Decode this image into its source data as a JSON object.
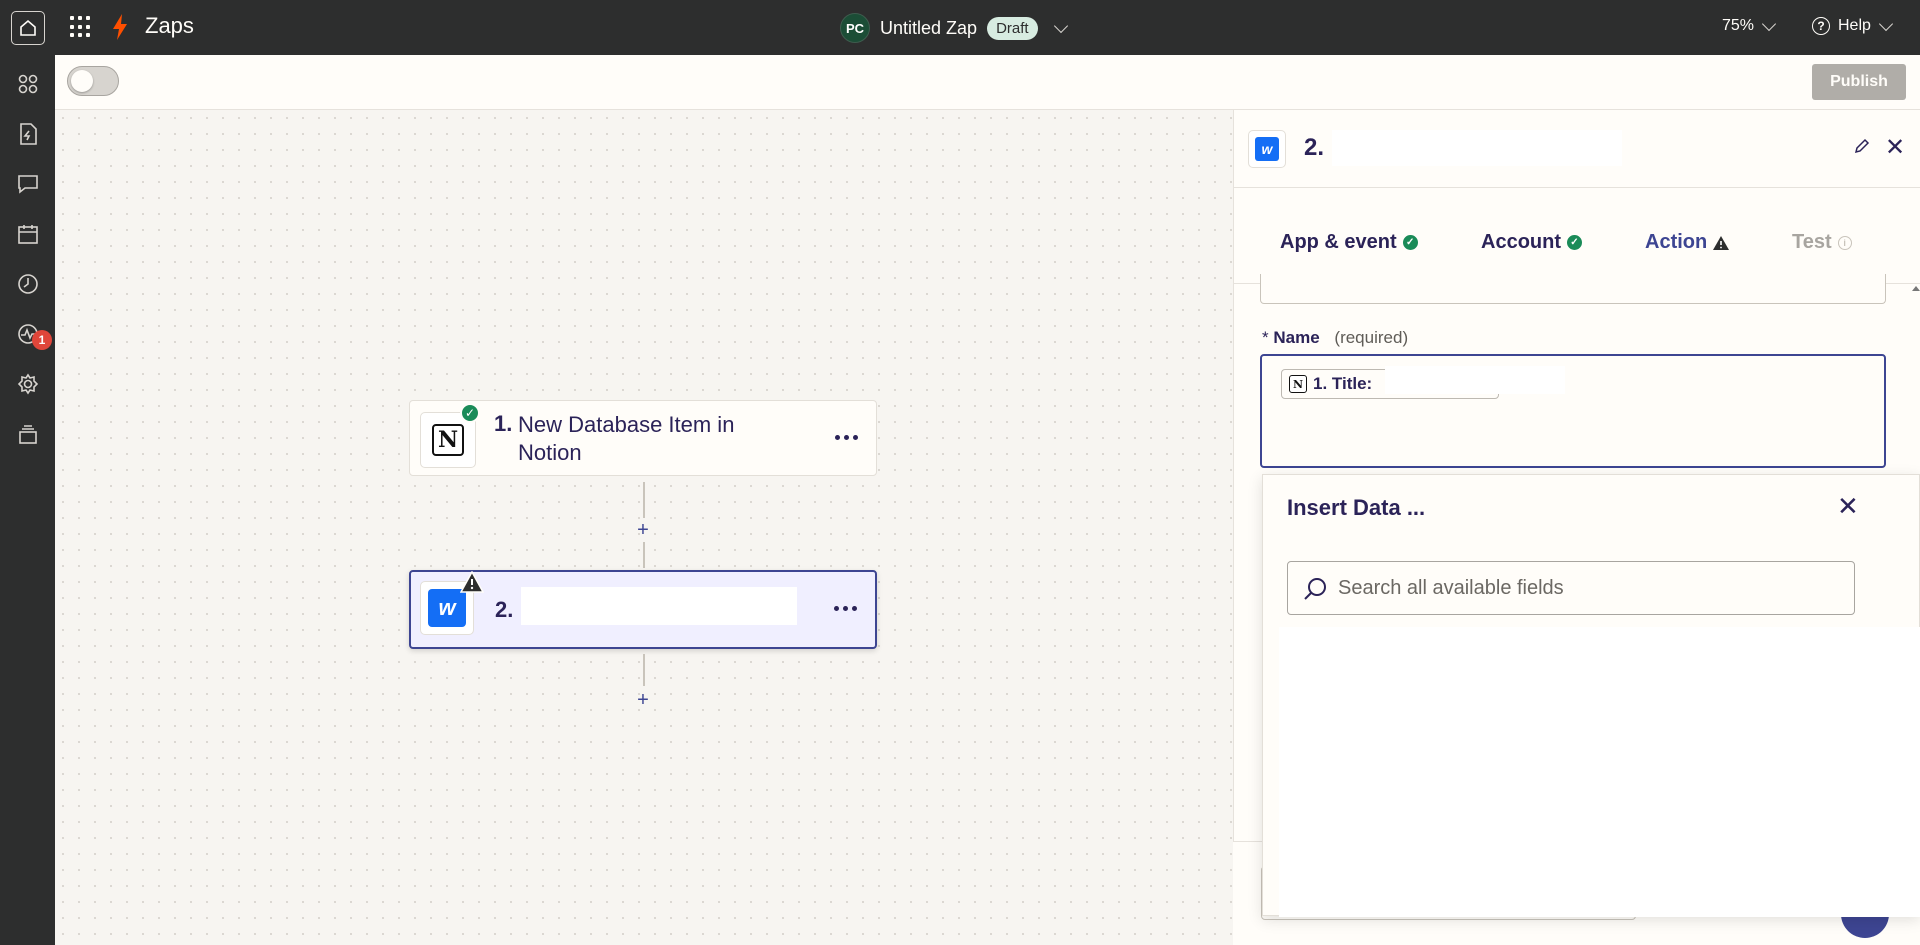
{
  "topbar": {
    "brand": "Zaps",
    "avatar_initials": "PC",
    "zap_title": "Untitled Zap",
    "status_badge": "Draft",
    "zoom": "75%",
    "help_label": "Help"
  },
  "left_rail": {
    "items": [
      {
        "icon": "apps-icon"
      },
      {
        "icon": "zap-file-icon"
      },
      {
        "icon": "chat-icon"
      },
      {
        "icon": "calendar-icon"
      },
      {
        "icon": "history-icon"
      },
      {
        "icon": "activity-icon",
        "badge": "1"
      },
      {
        "icon": "settings-icon"
      },
      {
        "icon": "layers-icon"
      }
    ],
    "copilot_icon": "sparkle-icon"
  },
  "toolbar": {
    "toggle_state": "off",
    "publish_label": "Publish"
  },
  "canvas": {
    "steps": [
      {
        "number": "1.",
        "title": "New Database Item in Notion",
        "app": "Notion",
        "status": "complete"
      },
      {
        "number": "2.",
        "title": "",
        "app": "Webflow",
        "status": "warning"
      }
    ],
    "add_step_symbol": "+"
  },
  "panel": {
    "step_number": "2.",
    "tabs": [
      {
        "label": "App & event",
        "status": "complete"
      },
      {
        "label": "Account",
        "status": "complete"
      },
      {
        "label": "Action",
        "status": "warning"
      },
      {
        "label": "Test",
        "status": "disabled"
      }
    ],
    "field": {
      "required_marker": "*",
      "label": "Name",
      "hint": "(required)",
      "pill_label": "1. Title:"
    }
  },
  "insert_data": {
    "title": "Insert Data ...",
    "search_placeholder": "Search all available fields"
  },
  "colors": {
    "topbar_bg": "#2d2e2e",
    "accent": "#3d4592",
    "brand_orange": "#ff4f00",
    "success": "#1a8b58",
    "webflow_blue": "#146ef5"
  }
}
